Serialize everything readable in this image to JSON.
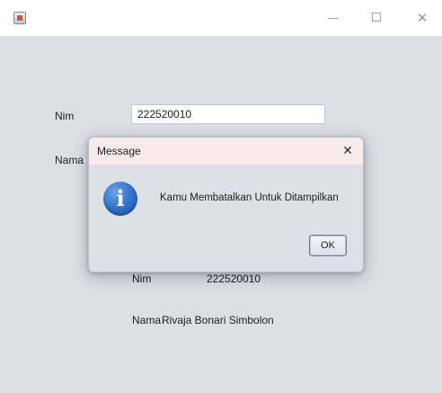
{
  "window": {
    "title": "",
    "minimize_glyph": "—",
    "maximize_glyph": "□",
    "close_glyph": "✕"
  },
  "form": {
    "nim_label": "Nim",
    "nim_value": "222520010",
    "nama_label": "Nama"
  },
  "output": {
    "nim_label": "Nim",
    "nim_value": "222520010",
    "nama_label": "Nama",
    "nama_value": "Rivaja Bonari Simbolon"
  },
  "dialog": {
    "title": "Message",
    "close_glyph": "✕",
    "icon": "info-icon",
    "icon_glyph": "i",
    "message": "Kamu Membatalkan Untuk Ditampilkan",
    "ok_label": "OK"
  },
  "colors": {
    "window_bg": "#dcdfe6",
    "dialog_title_bg": "#f9ebeb",
    "info_blue": "#2f6dc7"
  }
}
